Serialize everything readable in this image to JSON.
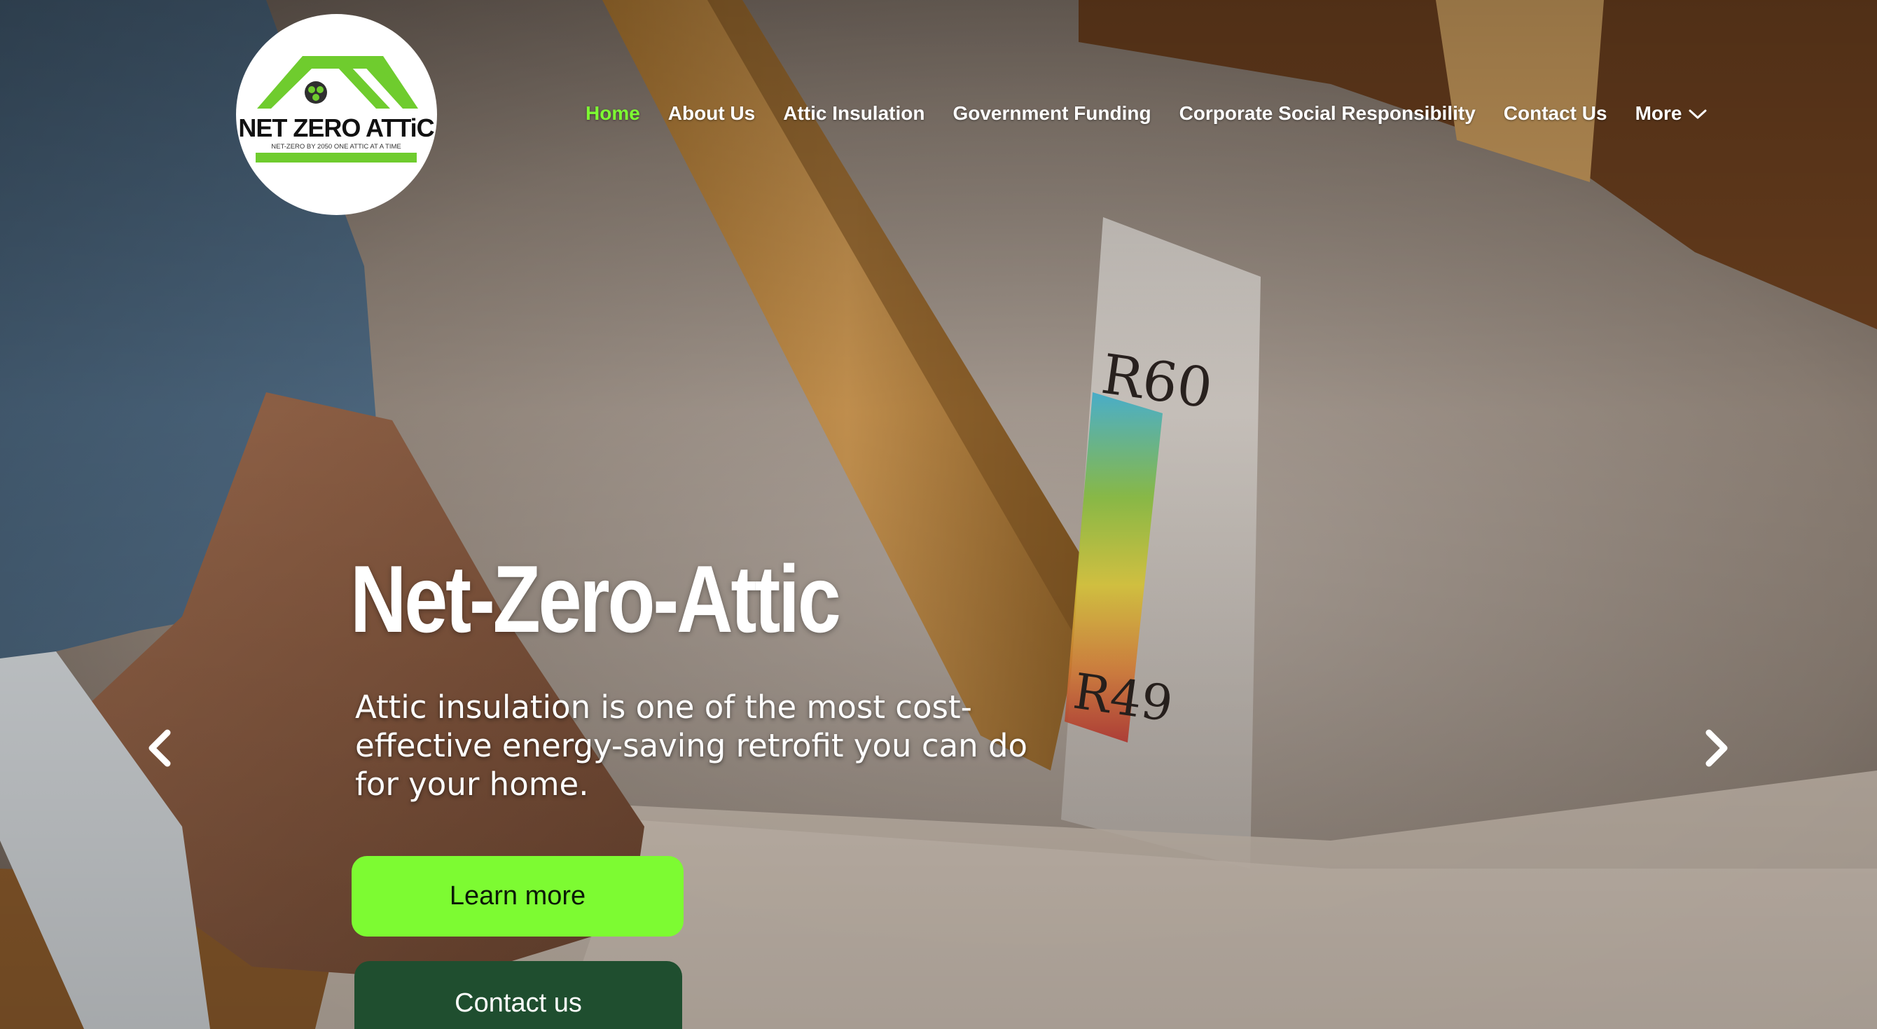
{
  "logo": {
    "title": "NET ZERO ATTiC",
    "tagline": "NET-ZERO BY 2050 ONE ATTIC AT A TIME",
    "green": "#6fcc2e"
  },
  "nav": {
    "items": [
      {
        "label": "Home",
        "active": true
      },
      {
        "label": "About Us",
        "active": false
      },
      {
        "label": "Attic Insulation",
        "active": false
      },
      {
        "label": "Government Funding",
        "active": false
      },
      {
        "label": "Corporate Social Responsibility",
        "active": false
      },
      {
        "label": "Contact Us",
        "active": false
      },
      {
        "label": "More",
        "active": false,
        "icon": "chevron-down-icon"
      }
    ]
  },
  "hero": {
    "headline": "Net-Zero-Attic",
    "subtitle": "Attic insulation is one of the most cost-effective energy-saving retrofit you can do for your home.",
    "learn_more_label": "Learn more",
    "contact_label": "Contact us",
    "prev_icon": "chevron-left-icon",
    "next_icon": "chevron-right-icon"
  },
  "colors": {
    "accent_green": "#7dfb32",
    "dark_green": "#1f4e2f",
    "text_white": "#ffffff"
  }
}
